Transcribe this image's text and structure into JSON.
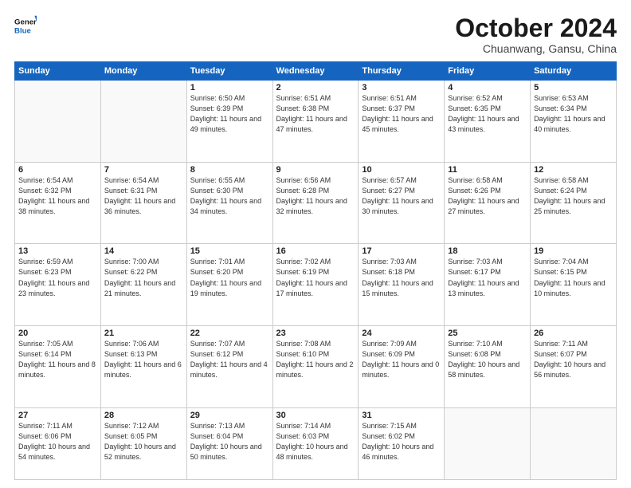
{
  "logo": {
    "line1": "General",
    "line2": "Blue"
  },
  "title": "October 2024",
  "subtitle": "Chuanwang, Gansu, China",
  "days": [
    "Sunday",
    "Monday",
    "Tuesday",
    "Wednesday",
    "Thursday",
    "Friday",
    "Saturday"
  ],
  "weeks": [
    [
      {
        "day": "",
        "text": ""
      },
      {
        "day": "",
        "text": ""
      },
      {
        "day": "1",
        "text": "Sunrise: 6:50 AM\nSunset: 6:39 PM\nDaylight: 11 hours and 49 minutes."
      },
      {
        "day": "2",
        "text": "Sunrise: 6:51 AM\nSunset: 6:38 PM\nDaylight: 11 hours and 47 minutes."
      },
      {
        "day": "3",
        "text": "Sunrise: 6:51 AM\nSunset: 6:37 PM\nDaylight: 11 hours and 45 minutes."
      },
      {
        "day": "4",
        "text": "Sunrise: 6:52 AM\nSunset: 6:35 PM\nDaylight: 11 hours and 43 minutes."
      },
      {
        "day": "5",
        "text": "Sunrise: 6:53 AM\nSunset: 6:34 PM\nDaylight: 11 hours and 40 minutes."
      }
    ],
    [
      {
        "day": "6",
        "text": "Sunrise: 6:54 AM\nSunset: 6:32 PM\nDaylight: 11 hours and 38 minutes."
      },
      {
        "day": "7",
        "text": "Sunrise: 6:54 AM\nSunset: 6:31 PM\nDaylight: 11 hours and 36 minutes."
      },
      {
        "day": "8",
        "text": "Sunrise: 6:55 AM\nSunset: 6:30 PM\nDaylight: 11 hours and 34 minutes."
      },
      {
        "day": "9",
        "text": "Sunrise: 6:56 AM\nSunset: 6:28 PM\nDaylight: 11 hours and 32 minutes."
      },
      {
        "day": "10",
        "text": "Sunrise: 6:57 AM\nSunset: 6:27 PM\nDaylight: 11 hours and 30 minutes."
      },
      {
        "day": "11",
        "text": "Sunrise: 6:58 AM\nSunset: 6:26 PM\nDaylight: 11 hours and 27 minutes."
      },
      {
        "day": "12",
        "text": "Sunrise: 6:58 AM\nSunset: 6:24 PM\nDaylight: 11 hours and 25 minutes."
      }
    ],
    [
      {
        "day": "13",
        "text": "Sunrise: 6:59 AM\nSunset: 6:23 PM\nDaylight: 11 hours and 23 minutes."
      },
      {
        "day": "14",
        "text": "Sunrise: 7:00 AM\nSunset: 6:22 PM\nDaylight: 11 hours and 21 minutes."
      },
      {
        "day": "15",
        "text": "Sunrise: 7:01 AM\nSunset: 6:20 PM\nDaylight: 11 hours and 19 minutes."
      },
      {
        "day": "16",
        "text": "Sunrise: 7:02 AM\nSunset: 6:19 PM\nDaylight: 11 hours and 17 minutes."
      },
      {
        "day": "17",
        "text": "Sunrise: 7:03 AM\nSunset: 6:18 PM\nDaylight: 11 hours and 15 minutes."
      },
      {
        "day": "18",
        "text": "Sunrise: 7:03 AM\nSunset: 6:17 PM\nDaylight: 11 hours and 13 minutes."
      },
      {
        "day": "19",
        "text": "Sunrise: 7:04 AM\nSunset: 6:15 PM\nDaylight: 11 hours and 10 minutes."
      }
    ],
    [
      {
        "day": "20",
        "text": "Sunrise: 7:05 AM\nSunset: 6:14 PM\nDaylight: 11 hours and 8 minutes."
      },
      {
        "day": "21",
        "text": "Sunrise: 7:06 AM\nSunset: 6:13 PM\nDaylight: 11 hours and 6 minutes."
      },
      {
        "day": "22",
        "text": "Sunrise: 7:07 AM\nSunset: 6:12 PM\nDaylight: 11 hours and 4 minutes."
      },
      {
        "day": "23",
        "text": "Sunrise: 7:08 AM\nSunset: 6:10 PM\nDaylight: 11 hours and 2 minutes."
      },
      {
        "day": "24",
        "text": "Sunrise: 7:09 AM\nSunset: 6:09 PM\nDaylight: 11 hours and 0 minutes."
      },
      {
        "day": "25",
        "text": "Sunrise: 7:10 AM\nSunset: 6:08 PM\nDaylight: 10 hours and 58 minutes."
      },
      {
        "day": "26",
        "text": "Sunrise: 7:11 AM\nSunset: 6:07 PM\nDaylight: 10 hours and 56 minutes."
      }
    ],
    [
      {
        "day": "27",
        "text": "Sunrise: 7:11 AM\nSunset: 6:06 PM\nDaylight: 10 hours and 54 minutes."
      },
      {
        "day": "28",
        "text": "Sunrise: 7:12 AM\nSunset: 6:05 PM\nDaylight: 10 hours and 52 minutes."
      },
      {
        "day": "29",
        "text": "Sunrise: 7:13 AM\nSunset: 6:04 PM\nDaylight: 10 hours and 50 minutes."
      },
      {
        "day": "30",
        "text": "Sunrise: 7:14 AM\nSunset: 6:03 PM\nDaylight: 10 hours and 48 minutes."
      },
      {
        "day": "31",
        "text": "Sunrise: 7:15 AM\nSunset: 6:02 PM\nDaylight: 10 hours and 46 minutes."
      },
      {
        "day": "",
        "text": ""
      },
      {
        "day": "",
        "text": ""
      }
    ]
  ]
}
